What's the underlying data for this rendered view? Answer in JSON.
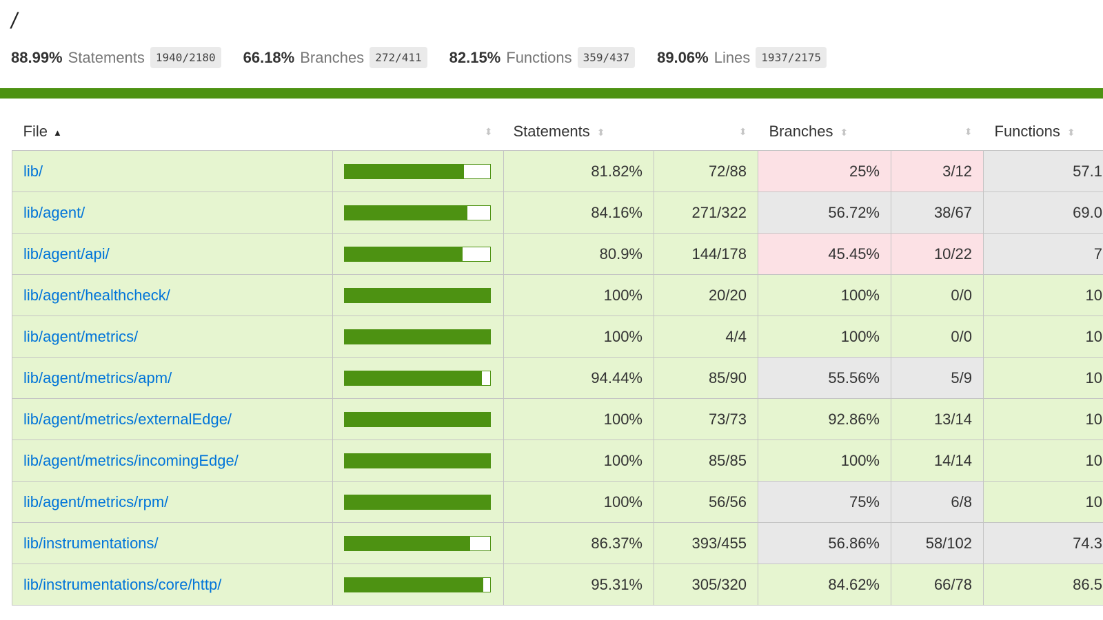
{
  "title": "/",
  "summary": [
    {
      "pct": "88.99%",
      "label": "Statements",
      "frac": "1940/2180"
    },
    {
      "pct": "66.18%",
      "label": "Branches",
      "frac": "272/411"
    },
    {
      "pct": "82.15%",
      "label": "Functions",
      "frac": "359/437"
    },
    {
      "pct": "89.06%",
      "label": "Lines",
      "frac": "1937/2175"
    }
  ],
  "colors": {
    "high": "#e6f5d0",
    "medium": "#e8e8e8",
    "low": "#fce1e5",
    "bar": "#4d9212",
    "link": "#0074d9"
  },
  "headers": {
    "file": "File",
    "sort_asc": "▲",
    "sort": "⬍",
    "statements": "Statements",
    "branches": "Branches",
    "functions": "Functions"
  },
  "rows": [
    {
      "file": "lib/",
      "stmt_pct": "81.82%",
      "stmt_value": 81.82,
      "stmt": "72/88",
      "br_pct": "25%",
      "br": "3/12",
      "br_level": "low",
      "fn": "57.1",
      "fn_level": "medium"
    },
    {
      "file": "lib/agent/",
      "stmt_pct": "84.16%",
      "stmt_value": 84.16,
      "stmt": "271/322",
      "br_pct": "56.72%",
      "br": "38/67",
      "br_level": "medium",
      "fn": "69.0",
      "fn_level": "medium"
    },
    {
      "file": "lib/agent/api/",
      "stmt_pct": "80.9%",
      "stmt_value": 80.9,
      "stmt": "144/178",
      "br_pct": "45.45%",
      "br": "10/22",
      "br_level": "low",
      "fn": "7",
      "fn_level": "medium"
    },
    {
      "file": "lib/agent/healthcheck/",
      "stmt_pct": "100%",
      "stmt_value": 100,
      "stmt": "20/20",
      "br_pct": "100%",
      "br": "0/0",
      "br_level": "high",
      "fn": "10",
      "fn_level": "high"
    },
    {
      "file": "lib/agent/metrics/",
      "stmt_pct": "100%",
      "stmt_value": 100,
      "stmt": "4/4",
      "br_pct": "100%",
      "br": "0/0",
      "br_level": "high",
      "fn": "10",
      "fn_level": "high"
    },
    {
      "file": "lib/agent/metrics/apm/",
      "stmt_pct": "94.44%",
      "stmt_value": 94.44,
      "stmt": "85/90",
      "br_pct": "55.56%",
      "br": "5/9",
      "br_level": "medium",
      "fn": "10",
      "fn_level": "high"
    },
    {
      "file": "lib/agent/metrics/externalEdge/",
      "stmt_pct": "100%",
      "stmt_value": 100,
      "stmt": "73/73",
      "br_pct": "92.86%",
      "br": "13/14",
      "br_level": "high",
      "fn": "10",
      "fn_level": "high"
    },
    {
      "file": "lib/agent/metrics/incomingEdge/",
      "stmt_pct": "100%",
      "stmt_value": 100,
      "stmt": "85/85",
      "br_pct": "100%",
      "br": "14/14",
      "br_level": "high",
      "fn": "10",
      "fn_level": "high"
    },
    {
      "file": "lib/agent/metrics/rpm/",
      "stmt_pct": "100%",
      "stmt_value": 100,
      "stmt": "56/56",
      "br_pct": "75%",
      "br": "6/8",
      "br_level": "medium",
      "fn": "10",
      "fn_level": "high"
    },
    {
      "file": "lib/instrumentations/",
      "stmt_pct": "86.37%",
      "stmt_value": 86.37,
      "stmt": "393/455",
      "br_pct": "56.86%",
      "br": "58/102",
      "br_level": "medium",
      "fn": "74.3",
      "fn_level": "medium"
    },
    {
      "file": "lib/instrumentations/core/http/",
      "stmt_pct": "95.31%",
      "stmt_value": 95.31,
      "stmt": "305/320",
      "br_pct": "84.62%",
      "br": "66/78",
      "br_level": "high",
      "fn": "86.5",
      "fn_level": "high"
    }
  ]
}
